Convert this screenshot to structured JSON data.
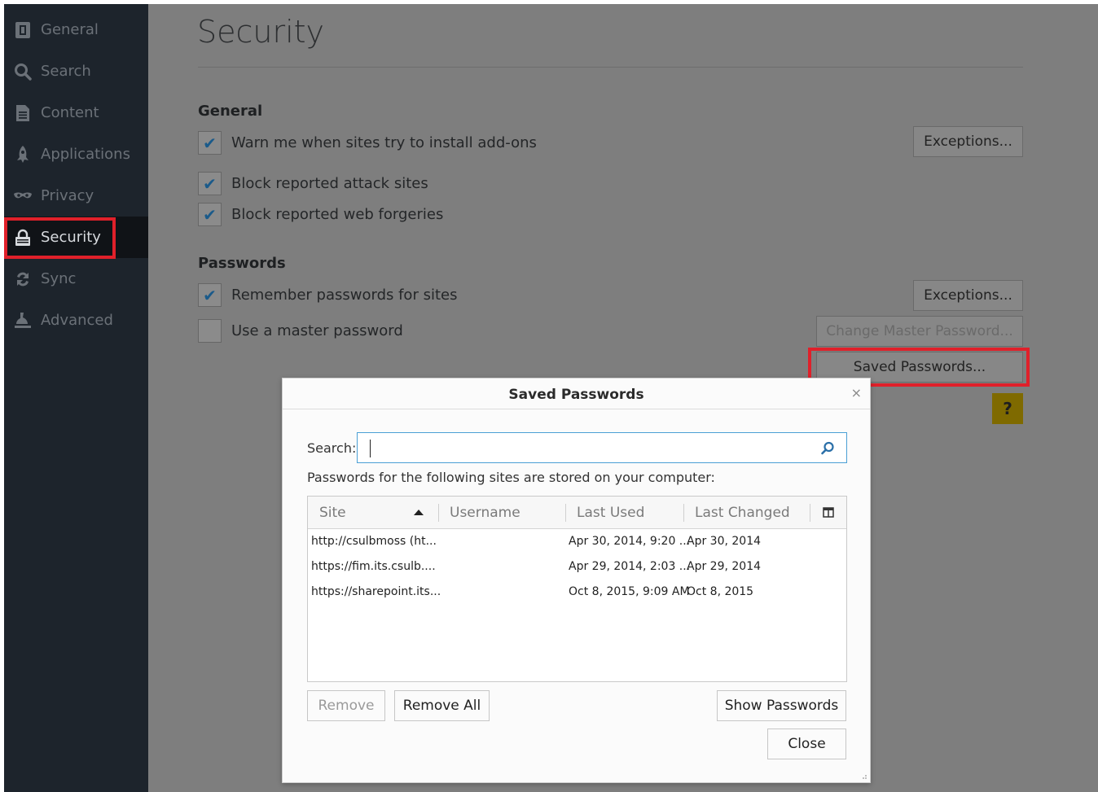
{
  "sidebar": {
    "items": [
      {
        "label": "General",
        "icon": "general-icon"
      },
      {
        "label": "Search",
        "icon": "search-icon"
      },
      {
        "label": "Content",
        "icon": "content-icon"
      },
      {
        "label": "Applications",
        "icon": "applications-icon"
      },
      {
        "label": "Privacy",
        "icon": "privacy-icon"
      },
      {
        "label": "Security",
        "icon": "security-lock-icon",
        "active": true
      },
      {
        "label": "Sync",
        "icon": "sync-icon"
      },
      {
        "label": "Advanced",
        "icon": "advanced-icon"
      }
    ]
  },
  "page": {
    "title": "Security",
    "general": {
      "heading": "General",
      "warn_addons": "Warn me when sites try to install add-ons",
      "block_attack": "Block reported attack sites",
      "block_forgeries": "Block reported web forgeries",
      "exceptions": "Exceptions..."
    },
    "passwords": {
      "heading": "Passwords",
      "remember": "Remember passwords for sites",
      "master": "Use a master password",
      "exceptions": "Exceptions...",
      "change_master": "Change Master Password...",
      "saved": "Saved Passwords..."
    },
    "help": "?"
  },
  "dialog": {
    "title": "Saved Passwords",
    "close": "×",
    "search_label": "Search:",
    "search_value": "",
    "info": "Passwords for the following sites are stored on your computer:",
    "columns": [
      "Site",
      "Username",
      "Last Used",
      "Last Changed"
    ],
    "rows": [
      {
        "site": "http://csulbmoss (ht...",
        "username": "",
        "last_used": "Apr 30, 2014, 9:20 ...",
        "last_changed": "Apr 30, 2014"
      },
      {
        "site": "https://fim.its.csulb....",
        "username": "",
        "last_used": "Apr 29, 2014, 2:03 ...",
        "last_changed": "Apr 29, 2014"
      },
      {
        "site": "https://sharepoint.its...",
        "username": "",
        "last_used": "Oct 8, 2015, 9:09 AM",
        "last_changed": "Oct 8, 2015"
      }
    ],
    "remove": "Remove",
    "remove_all": "Remove All",
    "show_passwords": "Show Passwords",
    "close_btn": "Close"
  },
  "colors": {
    "sidebar_bg": "#1d242c",
    "highlight": "#e0202a",
    "accent": "#4a9fd5",
    "help_bg": "#7f6a00"
  }
}
